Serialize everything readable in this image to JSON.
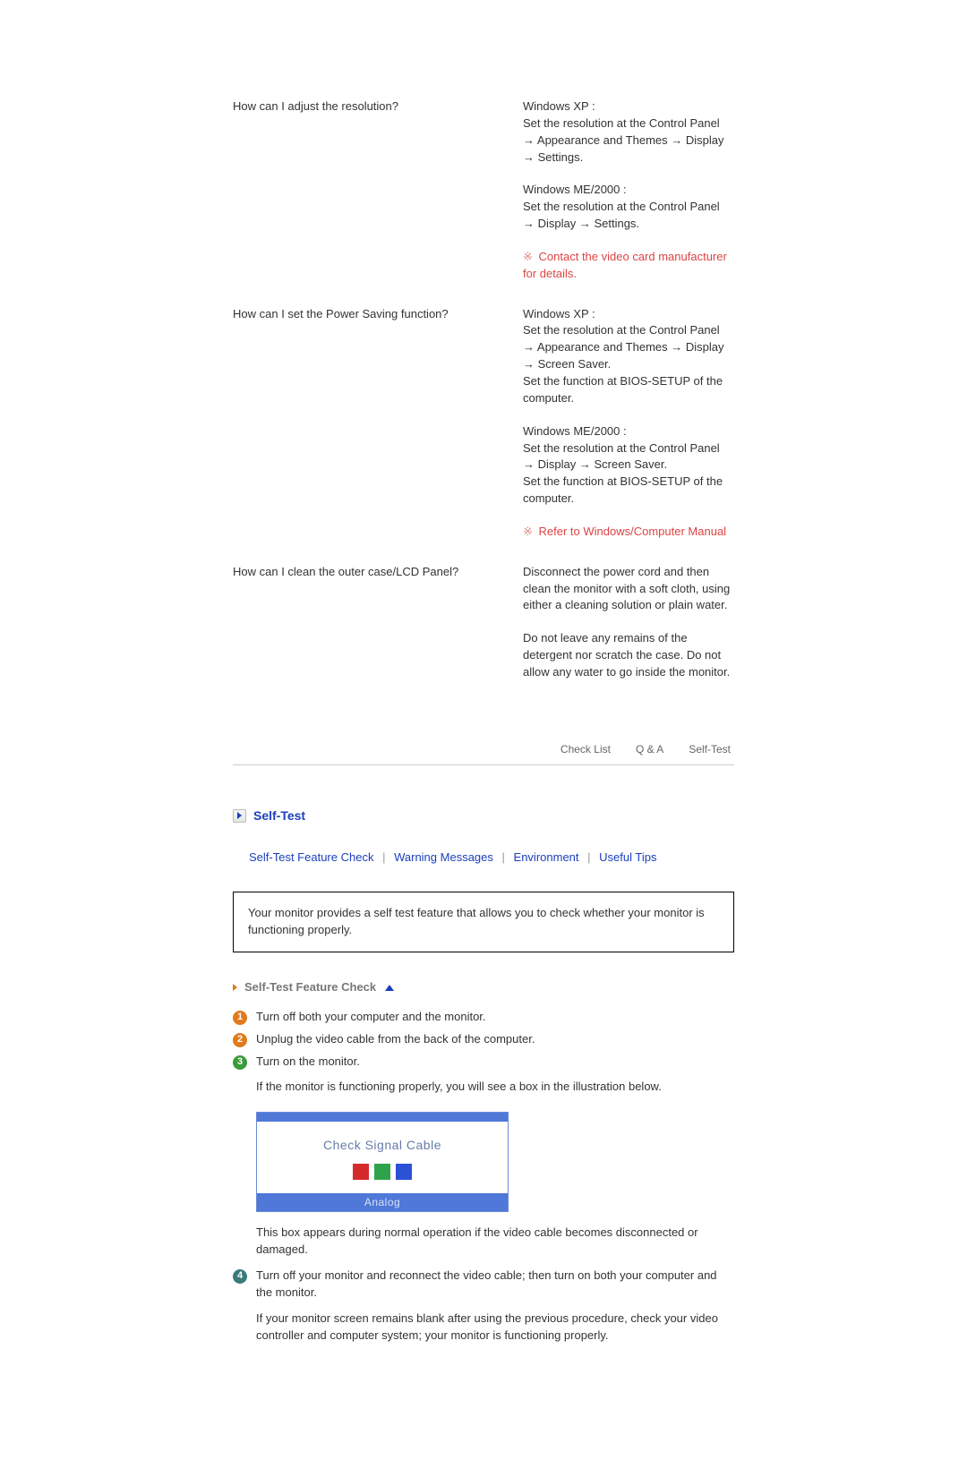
{
  "qa": [
    {
      "question": "How can I adjust the resolution?",
      "blocks": [
        "Windows XP :\nSet the resolution at the Control Panel → Appearance and Themes → Display → Settings.",
        "Windows ME/2000 :\nSet the resolution at the Control Panel → Display → Settings."
      ],
      "note_glyph": "※",
      "note": "Contact the video card manufacturer for details."
    },
    {
      "question": "How can I set the Power Saving function?",
      "blocks": [
        "Windows XP :\nSet the resolution at the Control Panel → Appearance and Themes → Display → Screen Saver.\nSet the function at BIOS-SETUP of the computer.",
        "Windows ME/2000 :\nSet the resolution at the Control Panel → Display → Screen Saver.\nSet the function at BIOS-SETUP of the computer."
      ],
      "note_glyph": "※",
      "note": "Refer to Windows/Computer Manual"
    },
    {
      "question": "How can I clean the outer case/LCD Panel?",
      "blocks": [
        "Disconnect the power cord and then clean the monitor with a soft cloth, using either a cleaning solution or plain water.",
        "Do not leave any remains of the detergent nor scratch the case. Do not allow any water to go inside the monitor."
      ],
      "note": null
    }
  ],
  "nav": {
    "check_list": "Check List",
    "qa": "Q & A",
    "self_test": "Self-Test"
  },
  "selftest": {
    "title": "Self-Test",
    "links": {
      "feature_check": "Self-Test Feature Check",
      "warning": "Warning Messages",
      "environment": "Environment",
      "tips": "Useful Tips"
    },
    "intro_box": "Your monitor provides a self test feature that allows you to check whether your monitor is functioning properly.",
    "feature_title": "Self-Test Feature Check",
    "steps": [
      {
        "badge": "1",
        "color": "#e07a1a",
        "text": "Turn off both your computer and the monitor."
      },
      {
        "badge": "2",
        "color": "#e07a1a",
        "text": "Unplug the video cable from the back of the computer."
      },
      {
        "badge": "3",
        "color": "#3a9b3a",
        "text": "Turn on the monitor."
      }
    ],
    "after_step3": "If the monitor is functioning properly, you will see a box in the illustration below.",
    "signal": {
      "text": "Check Signal Cable",
      "rgb": [
        "#d62a2a",
        "#2fa34a",
        "#2a52d6"
      ],
      "bottom": "Analog"
    },
    "after_signal": "This box appears during normal operation if the video cable becomes disconnected or damaged.",
    "step4": {
      "badge": "4",
      "color": "#3a7a7a",
      "line1": "Turn off your monitor and reconnect the video cable; then turn on both your computer and the monitor.",
      "line2": "If your monitor screen remains blank after using the previous procedure, check your video controller and computer system; your monitor is functioning properly."
    }
  }
}
